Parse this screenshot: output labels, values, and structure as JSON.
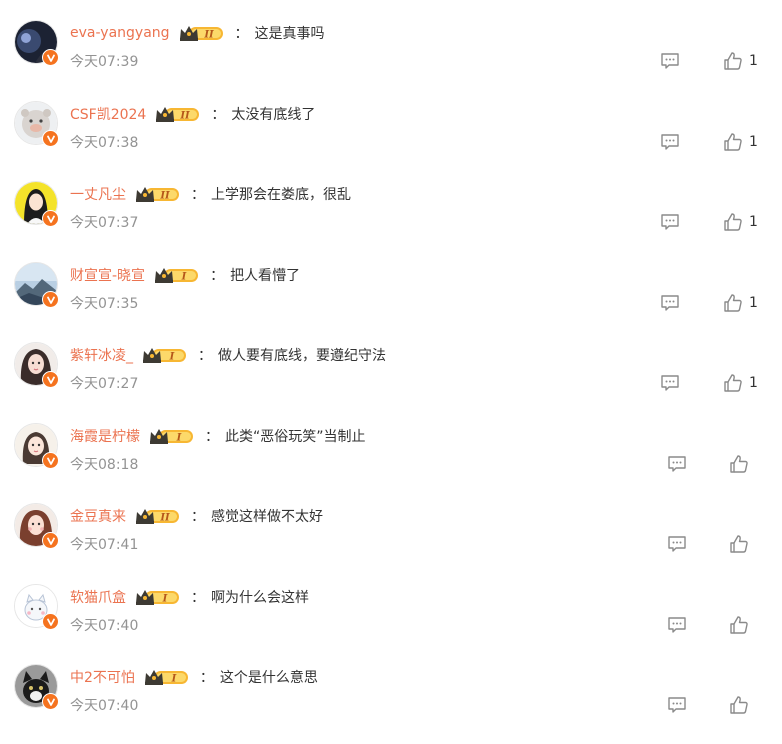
{
  "comments": [
    {
      "username": "eva-yangyang",
      "level": "II",
      "text": "这是真事吗",
      "time": "今天07:39",
      "likes": "1"
    },
    {
      "username": "CSF凯2024",
      "level": "II",
      "text": "太没有底线了",
      "time": "今天07:38",
      "likes": "1"
    },
    {
      "username": "一丈凡尘",
      "level": "II",
      "text": "上学那会在娄底，很乱",
      "time": "今天07:37",
      "likes": "1"
    },
    {
      "username": "财宣宣-晓宣",
      "level": "I",
      "text": "把人看懵了",
      "time": "今天07:35",
      "likes": "1"
    },
    {
      "username": "紫轩冰凌_",
      "level": "I",
      "text": "做人要有底线，要遵纪守法",
      "time": "今天07:27",
      "likes": "1"
    },
    {
      "username": "海霞是柠檬",
      "level": "I",
      "text": "此类“恶俗玩笑”当制止",
      "time": "今天08:18",
      "likes": ""
    },
    {
      "username": "金豆真来",
      "level": "II",
      "text": "感觉这样做不太好",
      "time": "今天07:41",
      "likes": ""
    },
    {
      "username": "软猫爪盒",
      "level": "I",
      "text": "啊为什么会这样",
      "time": "今天07:40",
      "likes": ""
    },
    {
      "username": "中2不可怕",
      "level": "I",
      "text": "这个是什么意思",
      "time": "今天07:40",
      "likes": ""
    }
  ],
  "separator": "：",
  "colors": {
    "username": "#eb7350",
    "time": "#939393",
    "badge": "#f5731f",
    "icon": "#8a8a8a"
  },
  "icons": {
    "reply": "comment-icon",
    "like": "thumbs-up-icon",
    "verified": "verified-v-icon",
    "level": "crown-level-badge-icon"
  }
}
